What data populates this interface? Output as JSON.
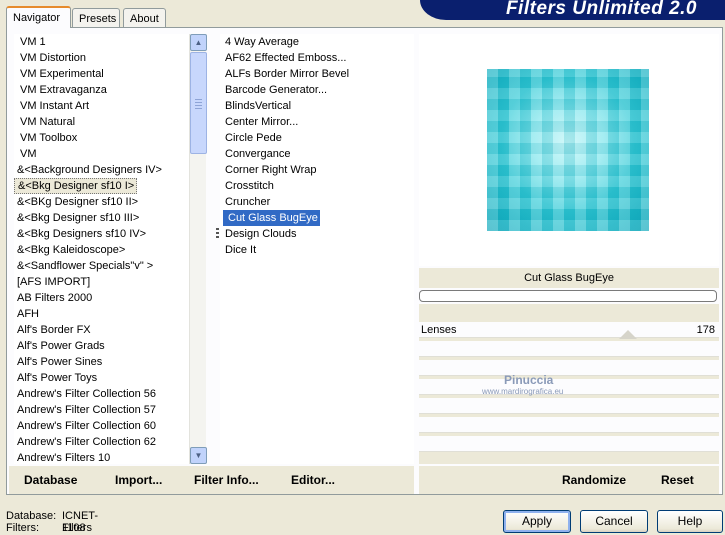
{
  "tabs": [
    "Navigator",
    "Presets",
    "About"
  ],
  "banner_title": "Filters Unlimited 2.0",
  "categories": [
    "VM 1",
    "VM Distortion",
    "VM Experimental",
    "VM Extravaganza",
    "VM Instant Art",
    "VM Natural",
    "VM Toolbox",
    "VM",
    "&<Background Designers IV>",
    "&<Bkg Designer sf10 I>",
    "&<BKg Designer sf10 II>",
    "&<Bkg Designer sf10 III>",
    "&<Bkg Designers sf10 IV>",
    "&<Bkg Kaleidoscope>",
    "&<Sandflower Specials\"v\" >",
    "[AFS IMPORT]",
    "AB Filters 2000",
    "AFH",
    "Alf's Border FX",
    "Alf's Power Grads",
    "Alf's Power Sines",
    "Alf's Power Toys",
    "Andrew's Filter Collection 56",
    "Andrew's Filter Collection 57",
    "Andrew's Filter Collection 60",
    "Andrew's Filter Collection 62",
    "Andrew's Filters 10"
  ],
  "filters": [
    "4 Way Average",
    "AF62 Effected Emboss...",
    "ALFs Border Mirror Bevel",
    "Barcode Generator...",
    "BlindsVertical",
    "Center Mirror...",
    "Circle Pede",
    "Convergance",
    "Corner Right Wrap",
    "Crosstitch",
    "Cruncher",
    "Cut Glass  BugEye",
    "Design Clouds",
    "Dice It"
  ],
  "left_bar": {
    "database": "Database",
    "import": "Import...",
    "filter_info": "Filter Info...",
    "editor": "Editor..."
  },
  "right_bar": {
    "randomize": "Randomize",
    "reset": "Reset"
  },
  "selected_filter_name": "Cut Glass  BugEye",
  "param": {
    "name": "Lenses",
    "value": "178"
  },
  "watermark": {
    "line1": "Pinuccia",
    "line2": "www.mardirografica.eu"
  },
  "status": {
    "database_label": "Database:",
    "database_value": "ICNET-Filters",
    "filters_label": "Filters:",
    "filters_value": "1108"
  },
  "buttons": {
    "apply": "Apply",
    "cancel": "Cancel",
    "help": "Help"
  }
}
